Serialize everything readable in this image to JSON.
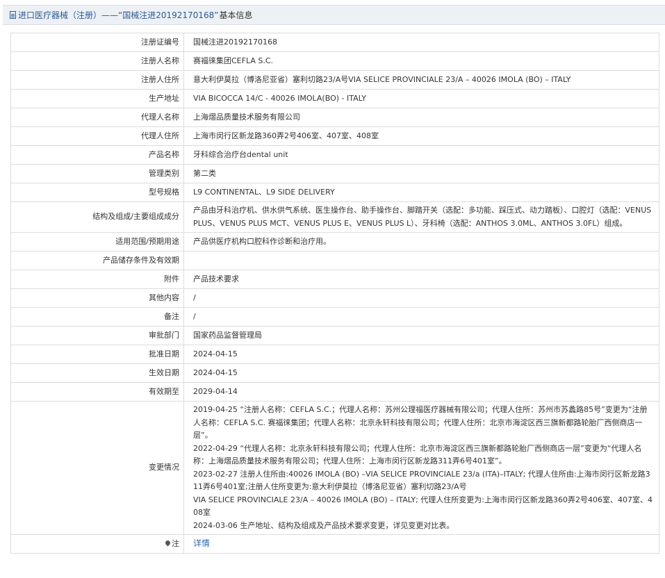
{
  "header": {
    "prefix": "进口医疗器械（注册）",
    "dash": "——",
    "quoted_id": "“国械注进20192170168”",
    "suffix": "基本信息"
  },
  "fields": [
    {
      "label": "注册证编号",
      "value": "国械注进20192170168"
    },
    {
      "label": "注册人名称",
      "value": "赛福徕集团CEFLA S.C."
    },
    {
      "label": "注册人住所",
      "value": "意大利伊莫拉（博洛尼亚省）塞利切路23/A号VIA SELICE PROVINCIALE 23/A – 40026 IMOLA (BO) – ITALY"
    },
    {
      "label": "生产地址",
      "value": "VIA BICOCCA 14/C - 40026 IMOLA(BO) - ITALY"
    },
    {
      "label": "代理人名称",
      "value": "上海熠品质量技术服务有限公司"
    },
    {
      "label": "代理人住所",
      "value": "上海市闵行区新龙路360弄2号406室、407室、408室"
    },
    {
      "label": "产品名称",
      "value": "牙科综合治疗台dental unit"
    },
    {
      "label": "管理类别",
      "value": "第二类"
    },
    {
      "label": "型号规格",
      "value": "L9 CONTINENTAL、L9 SIDE DELIVERY"
    },
    {
      "label": "结构及组成/主要组成成分",
      "value": "产品由牙科治疗机、供水供气系统、医生操作台、助手操作台、脚踏开关（选配：多功能、踩压式、动力踏板）、口腔灯（选配：VENUS PLUS、VENUS PLUS MCT、VENUS PLUS E、VENUS PLUS L）、牙科椅（选配：ANTHOS 3.0ML、ANTHOS 3.0FL）组成。"
    },
    {
      "label": "适用范围/预期用途",
      "value": "产品供医疗机构口腔科作诊断和治疗用。"
    },
    {
      "label": "产品储存条件及有效期",
      "value": ""
    },
    {
      "label": "附件",
      "value": "产品技术要求"
    },
    {
      "label": "其他内容",
      "value": "/"
    },
    {
      "label": "备注",
      "value": "/"
    },
    {
      "label": "审批部门",
      "value": "国家药品监督管理局"
    },
    {
      "label": "批准日期",
      "value": "2024-04-15"
    },
    {
      "label": "生效日期",
      "value": "2024-04-15"
    },
    {
      "label": "有效期至",
      "value": "2029-04-14"
    }
  ],
  "changes": {
    "label": "变更情况",
    "entries": [
      "2019-04-25 “注册人名称：CEFLA S.C.；代理人名称：苏州公理福医疗器械有限公司；代理人住所：苏州市苏蠡路85号”变更为“注册人名称：CEFLA S.C. 赛福徕集团；代理人名称：北京永轩科技有限公司；代理人住所：北京市海淀区西三旗新都路轮胎厂西侧商店一层”。",
      "2022-04-29 “代理人名称：北京永轩科技有限公司；代理人住所：北京市海淀区西三旗新都路轮胎厂西侧商店一层”变更为“代理人名称：上海熠品质量技术服务有限公司；代理人住所：上海市闵行区新龙路311弄6号401室”。",
      "2023-02-27 注册人住所由:40026 IMOLA (BO) –VIA SELICE PROVINCIALE 23/a (ITA)–ITALY; 代理人住所由:上海市闵行区新龙路311弄6号401室;注册人住所变更为:意大利伊莫拉（博洛尼亚省）塞利切路23/A号",
      "VIA SELICE PROVINCIALE 23/A – 40026 IMOLA (BO) – ITALY; 代理人住所变更为:上海市闵行区新龙路360弄2号406室、407室、408室",
      "2024-03-06 生产地址、结构及组成及产品技术要求变更，详见变更对比表。"
    ]
  },
  "note": {
    "label": "注",
    "icon": "map-pin-icon",
    "link_text": "详情"
  },
  "colors": {
    "header_bg": "#edf0f4",
    "header_text": "#2a5a98",
    "border": "#dcdcdc",
    "link": "#2a6ab8"
  }
}
